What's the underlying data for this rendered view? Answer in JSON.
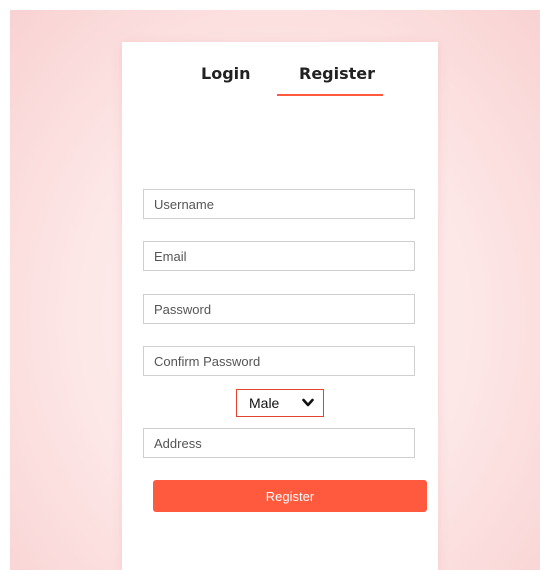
{
  "tabs": {
    "login": "Login",
    "register": "Register",
    "active": "register"
  },
  "form": {
    "username_placeholder": "Username",
    "email_placeholder": "Email",
    "password_placeholder": "Password",
    "confirm_password_placeholder": "Confirm Password",
    "gender_selected": "Male",
    "address_placeholder": "Address",
    "submit_label": "Register"
  },
  "colors": {
    "accent": "#ff5a3d",
    "select_border": "#e0442c",
    "background_tint": "#fde6e6"
  },
  "icons": {
    "gender_dropdown": "chevron-down-icon"
  }
}
